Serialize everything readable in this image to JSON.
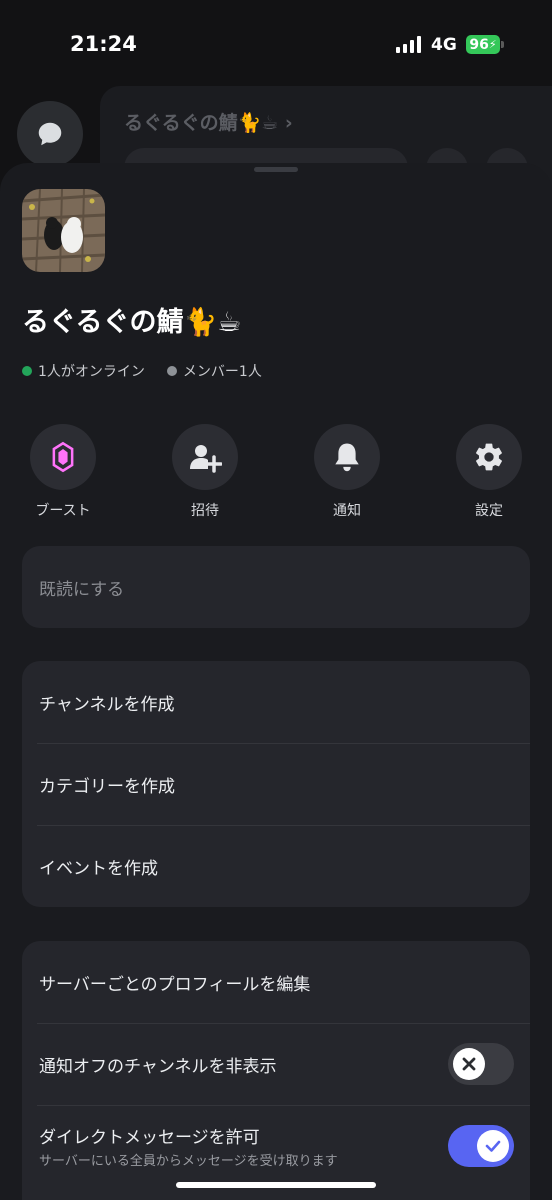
{
  "status_bar": {
    "time": "21:24",
    "network": "4G",
    "battery": "96"
  },
  "background": {
    "channel_title": "るぐるぐの鯖🐈☕ ›"
  },
  "server": {
    "name": "るぐるぐの鯖🐈☕",
    "online": "1人がオンライン",
    "members": "メンバー1人"
  },
  "actions": [
    {
      "label": "ブースト",
      "icon": "boost-icon"
    },
    {
      "label": "招待",
      "icon": "invite-icon"
    },
    {
      "label": "通知",
      "icon": "bell-icon"
    },
    {
      "label": "設定",
      "icon": "gear-icon"
    }
  ],
  "mark_read": "既読にする",
  "create_menu": {
    "channel": "チャンネルを作成",
    "category": "カテゴリーを作成",
    "event": "イベントを作成"
  },
  "settings_menu": {
    "edit_profile": "サーバーごとのプロフィールを編集",
    "hide_muted": "通知オフのチャンネルを非表示",
    "hide_muted_on": false,
    "allow_dm": "ダイレクトメッセージを許可",
    "allow_dm_sub": "サーバーにいる全員からメッセージを受け取ります",
    "allow_dm_on": true
  },
  "colors": {
    "online": "#23a55a",
    "offline": "#8e9297",
    "accent": "#5865f2",
    "boost": "#ff73fa"
  }
}
